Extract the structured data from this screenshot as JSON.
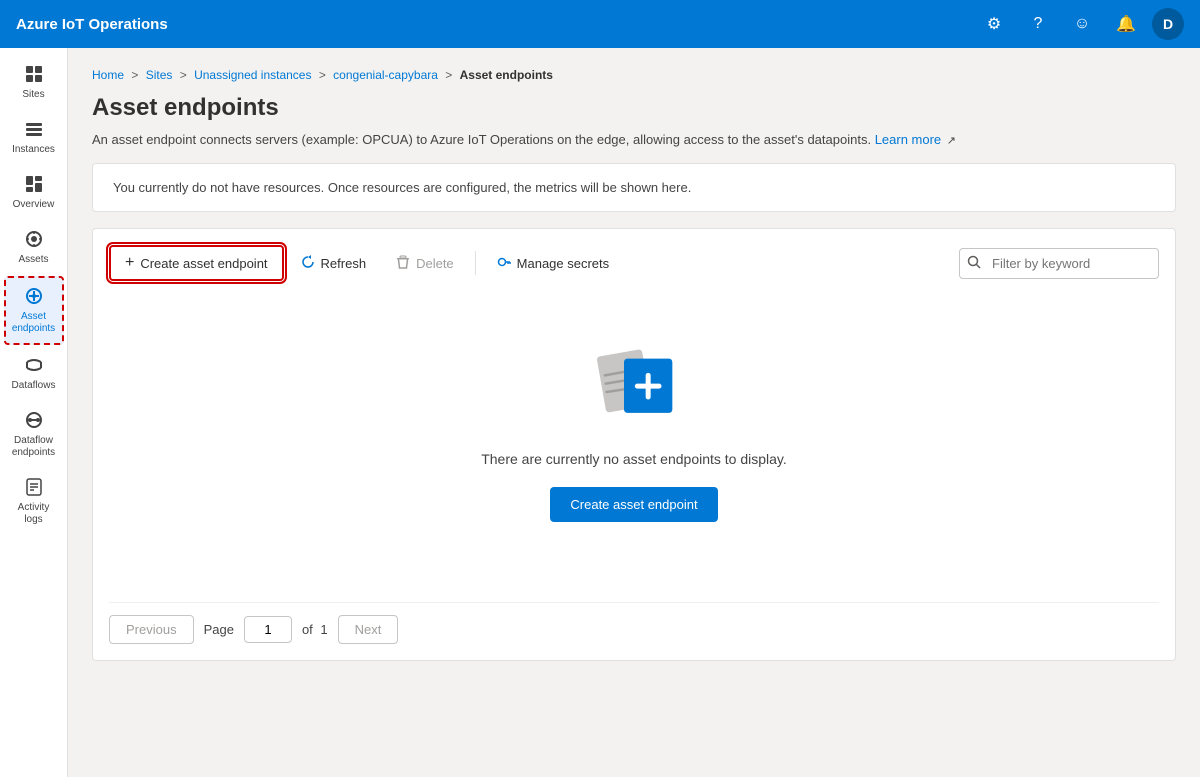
{
  "topNav": {
    "title": "Azure IoT Operations",
    "avatar": "D"
  },
  "sidebar": {
    "items": [
      {
        "id": "sites",
        "label": "Sites",
        "icon": "⊞"
      },
      {
        "id": "instances",
        "label": "Instances",
        "icon": "⊟"
      },
      {
        "id": "overview",
        "label": "Overview",
        "icon": "▣"
      },
      {
        "id": "assets",
        "label": "Assets",
        "icon": "⚙"
      },
      {
        "id": "asset-endpoints",
        "label": "Asset endpoints",
        "icon": "⊕",
        "active": true
      },
      {
        "id": "dataflows",
        "label": "Dataflows",
        "icon": "⇌"
      },
      {
        "id": "dataflow-endpoints",
        "label": "Dataflow endpoints",
        "icon": "⊗"
      },
      {
        "id": "activity-logs",
        "label": "Activity logs",
        "icon": "≡"
      }
    ]
  },
  "breadcrumb": {
    "items": [
      "Home",
      "Sites",
      "Unassigned instances",
      "congenial-capybara"
    ],
    "current": "Asset endpoints"
  },
  "page": {
    "title": "Asset endpoints",
    "description": "An asset endpoint connects servers (example: OPCUA) to Azure IoT Operations on the edge, allowing access to the asset's datapoints.",
    "learnMore": "Learn more",
    "infoBanner": "You currently do not have resources. Once resources are configured, the metrics will be shown here."
  },
  "toolbar": {
    "createLabel": "Create asset endpoint",
    "refreshLabel": "Refresh",
    "deleteLabel": "Delete",
    "manageSecretsLabel": "Manage secrets",
    "filterPlaceholder": "Filter by keyword"
  },
  "emptyState": {
    "text": "There are currently no asset endpoints to display.",
    "createLabel": "Create asset endpoint"
  },
  "pagination": {
    "previousLabel": "Previous",
    "nextLabel": "Next",
    "pageLabel": "Page",
    "ofLabel": "of",
    "currentPage": "1",
    "totalPages": "1"
  }
}
